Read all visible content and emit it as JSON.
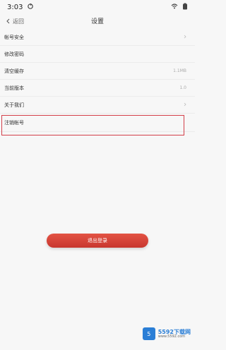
{
  "status_bar": {
    "time": "3:03",
    "icons": [
      "sync-icon",
      "wifi-icon",
      "battery-icon"
    ]
  },
  "header": {
    "back_label": "返回",
    "title": "设置"
  },
  "settings": {
    "items": [
      {
        "label": "帐号安全",
        "value": ""
      },
      {
        "label": "修改密码",
        "value": ""
      },
      {
        "label": "清空缓存",
        "value": "1.1MB"
      },
      {
        "label": "当前版本",
        "value": "1.0"
      },
      {
        "label": "关于我们",
        "value": ""
      },
      {
        "label": "注销帐号",
        "value": ""
      }
    ]
  },
  "actions": {
    "logout_label": "退出登录"
  },
  "watermark": {
    "badge": "5",
    "main": "5592下载网",
    "sub": "www.5592.com"
  },
  "colors": {
    "accent": "#d33f49",
    "background": "#f7f7f7"
  }
}
